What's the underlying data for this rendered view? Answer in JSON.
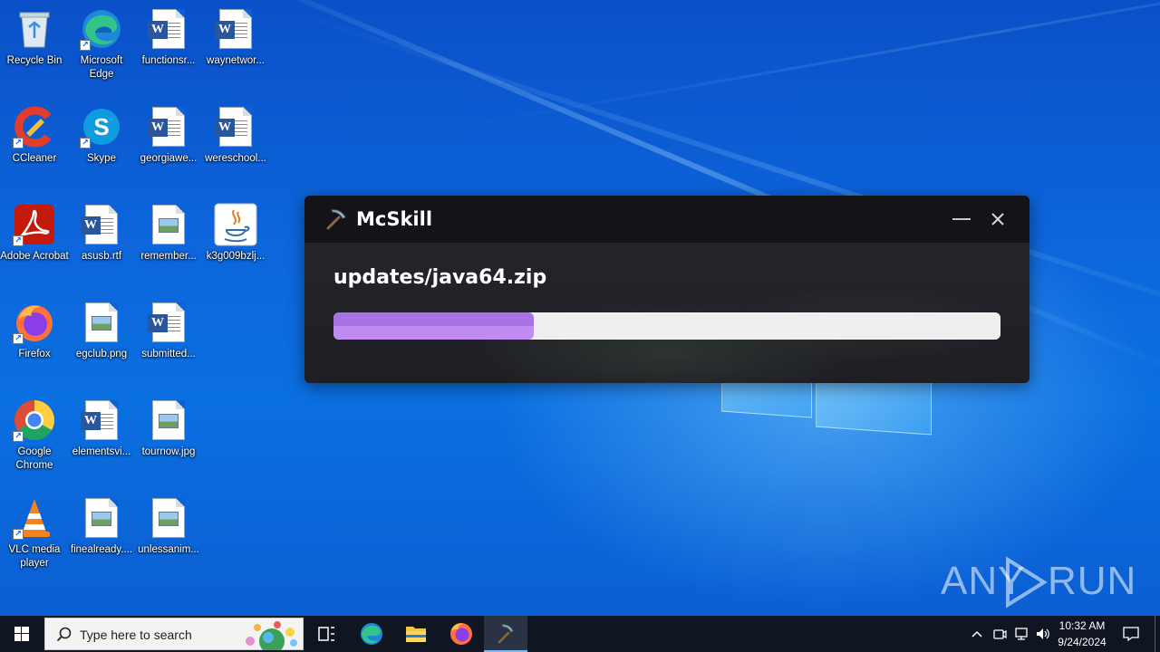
{
  "desktop": {
    "icons": [
      {
        "label": "Recycle Bin",
        "icon": "recycle-bin-icon"
      },
      {
        "label": "Microsoft Edge",
        "icon": "edge-icon"
      },
      {
        "label": "functionsr...",
        "icon": "word-doc-icon"
      },
      {
        "label": "waynetwor...",
        "icon": "word-doc-icon"
      },
      {
        "label": "CCleaner",
        "icon": "ccleaner-icon"
      },
      {
        "label": "Skype",
        "icon": "skype-icon"
      },
      {
        "label": "georgiawe...",
        "icon": "word-doc-icon"
      },
      {
        "label": "wereschool...",
        "icon": "word-doc-icon"
      },
      {
        "label": "Adobe Acrobat",
        "icon": "acrobat-icon"
      },
      {
        "label": "asusb.rtf",
        "icon": "word-doc-icon"
      },
      {
        "label": "remember...",
        "icon": "image-file-icon"
      },
      {
        "label": "k3g009bzlj...",
        "icon": "java-icon"
      },
      {
        "label": "Firefox",
        "icon": "firefox-icon"
      },
      {
        "label": "egclub.png",
        "icon": "image-file-icon"
      },
      {
        "label": "submitted...",
        "icon": "word-doc-icon"
      },
      {
        "label": "Google Chrome",
        "icon": "chrome-icon"
      },
      {
        "label": "elementsvi...",
        "icon": "word-doc-icon"
      },
      {
        "label": "tournow.jpg",
        "icon": "image-file-icon"
      },
      {
        "label": "VLC media player",
        "icon": "vlc-icon"
      },
      {
        "label": "finealready....",
        "icon": "image-file-icon"
      },
      {
        "label": "unlessanim...",
        "icon": "image-file-icon"
      }
    ]
  },
  "launcher": {
    "title": "McSkill",
    "current_file": "updates/java64.zip",
    "progress_percent": 30,
    "accent_color": "#b07ae8"
  },
  "watermark": {
    "left": "ANY",
    "right": "RUN"
  },
  "taskbar": {
    "search_placeholder": "Type here to search",
    "clock_time": "10:32 AM",
    "clock_date": "9/24/2024"
  }
}
